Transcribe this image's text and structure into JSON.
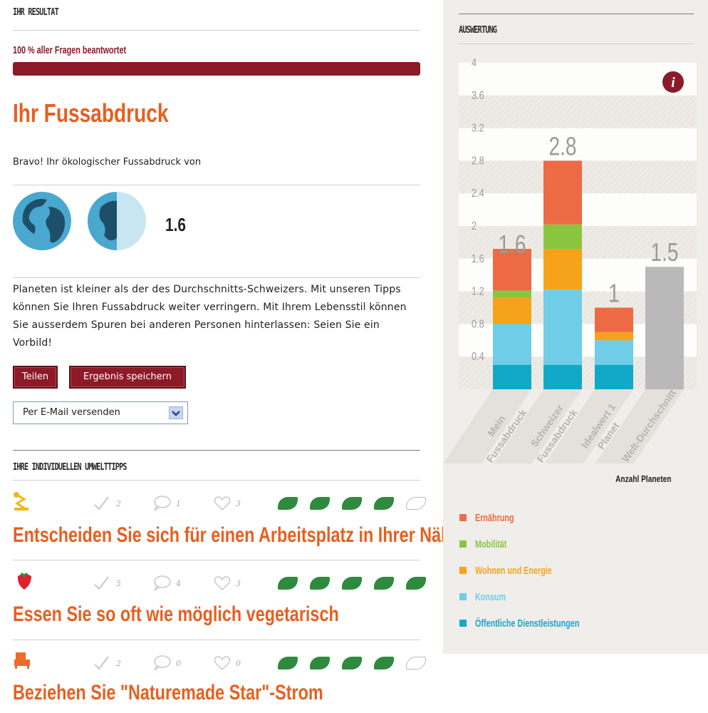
{
  "result": {
    "header": "IHR RESULTAT",
    "progress_label": "100 % aller Fragen beantwortet",
    "progress_value": 1.0,
    "title": "Ihr Fussabdruck",
    "intro": "Bravo! Ihr ökologischer Fussabdruck von",
    "planet_value": "1.6",
    "description": "Planeten ist kleiner als der des Durchschnitts-Schweizers. Mit unseren Tipps können Sie Ihren Fussabdruck weiter verringern. Mit Ihrem Lebensstil können Sie ausserdem Spuren bei anderen Personen hinterlassen: Seien Sie ein Vorbild!",
    "share_button": "Teilen",
    "save_button": "Ergebnis speichern",
    "send_select_value": "Per E-Mail versenden"
  },
  "tips": {
    "header": "IHRE INDIVIDUELLEN UMWELTTIPPS",
    "items": [
      {
        "icon": "desk-lamp-icon",
        "done": "2",
        "comments": "1",
        "likes": "3",
        "leaves": 4,
        "title": "Entscheiden Sie sich für einen Arbeitsplatz in Ihrer Nähe"
      },
      {
        "icon": "strawberry-icon",
        "done": "5",
        "comments": "4",
        "likes": "3",
        "leaves": 5,
        "title": "Essen Sie so oft wie möglich vegetarisch"
      },
      {
        "icon": "armchair-icon",
        "done": "2",
        "comments": "0",
        "likes": "0",
        "leaves": 4,
        "title": "Beziehen Sie \"Naturemade Star\"-Strom"
      }
    ]
  },
  "chart_panel": {
    "header": "AUSWERTUNG",
    "info_icon": "info-icon",
    "unit_label": "Anzahl Planeten"
  },
  "chart_data": {
    "type": "bar",
    "stacked": true,
    "ylim": [
      0,
      4
    ],
    "yticks": [
      "0.4",
      "0.8",
      "1.2",
      "1.6",
      "2",
      "2.4",
      "2.8",
      "3.2",
      "3.6",
      "4"
    ],
    "categories": [
      "Mein Fussabdruck",
      "Schweizer Fussabdruck",
      "Idealwert 1 Planet",
      "Welt-Durchschnitt"
    ],
    "totals": [
      "1.6",
      "2.8",
      "1",
      "1.5"
    ],
    "colors": {
      "ernaehrung": "#ee6a45",
      "mobilitaet": "#8bc53f",
      "wohnen": "#f5a31a",
      "konsum": "#6fcde7",
      "oeffentlich": "#12a8c8",
      "welt": "#b9b9b9"
    },
    "series": [
      {
        "name": "Öffentliche Dienstleistungen",
        "color": "#12a8c8",
        "values": [
          0.3,
          0.3,
          0.3,
          0
        ]
      },
      {
        "name": "Konsum",
        "color": "#6fcde7",
        "values": [
          0.5,
          0.92,
          0.3,
          0
        ]
      },
      {
        "name": "Wohnen und Energie",
        "color": "#f5a31a",
        "values": [
          0.32,
          0.5,
          0.1,
          0
        ]
      },
      {
        "name": "Mobilität",
        "color": "#8bc53f",
        "values": [
          0.09,
          0.3,
          0,
          0
        ]
      },
      {
        "name": "Ernährung",
        "color": "#ee6a45",
        "values": [
          0.51,
          0.78,
          0.3,
          0
        ]
      },
      {
        "name": "",
        "color": "#b9b9b9",
        "values": [
          0,
          0,
          0,
          1.5
        ]
      }
    ],
    "legend": [
      {
        "label": "Ernährung",
        "color": "#ee6a45"
      },
      {
        "label": "Mobilität",
        "color": "#8bc53f"
      },
      {
        "label": "Wohnen und Energie",
        "color": "#f5a31a"
      },
      {
        "label": "Konsum",
        "color": "#6fcde7"
      },
      {
        "label": "Öffentliche Dienstleistungen",
        "color": "#12a8c8"
      }
    ]
  }
}
